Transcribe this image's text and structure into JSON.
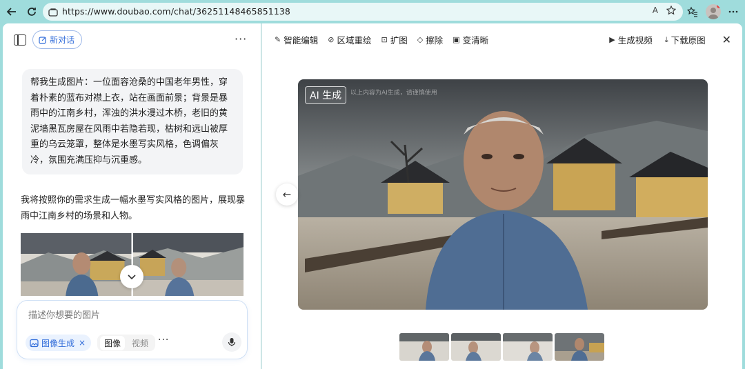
{
  "browser": {
    "url": "https://www.doubao.com/chat/36251148465851138",
    "read_aloud": "A",
    "icons": [
      "back-icon",
      "refresh-icon",
      "site-info-icon",
      "read-aloud-icon",
      "favorite-star-icon",
      "collections-icon",
      "profile-avatar"
    ]
  },
  "left": {
    "new_chat_label": "新对话",
    "more": "···",
    "user_message": "帮我生成图片：一位面容沧桑的中国老年男性，穿着朴素的蓝布对襟上衣，站在画面前景；背景是暴雨中的江南乡村，浑浊的洪水漫过木桥，老旧的黄泥墙黑瓦房屋在风雨中若隐若现，枯树和远山被厚重的乌云笼罩，整体是水墨写实风格，色调偏灰冷，氛围充满压抑与沉重感。",
    "assistant_message": "我将按照你的需求生成一幅水墨写实风格的图片，展现暴雨中江南乡村的场景和人物。",
    "composer": {
      "placeholder": "描述你想要的图片",
      "chip_label": "图像生成",
      "chip_close": "×",
      "tab_image": "图像",
      "tab_video": "视频",
      "more": "···"
    }
  },
  "right": {
    "toolbar": {
      "smart_edit": "智能编辑",
      "region_redraw": "区域重绘",
      "expand": "扩图",
      "erase": "擦除",
      "sharpen": "变清晰",
      "gen_video": "生成视频",
      "download": "下载原图",
      "close": "✕"
    },
    "image": {
      "badge": "AI 生成",
      "watermark": "以上内容为AI生成，请谨慎使用",
      "prev": "←"
    },
    "thumbnails_count": 4,
    "selected_thumbnail": 4
  },
  "colors": {
    "browser_bg": "#9fdcdc",
    "accent_blue": "#2f6bd9",
    "bubble_bg": "#f3f4f6"
  }
}
